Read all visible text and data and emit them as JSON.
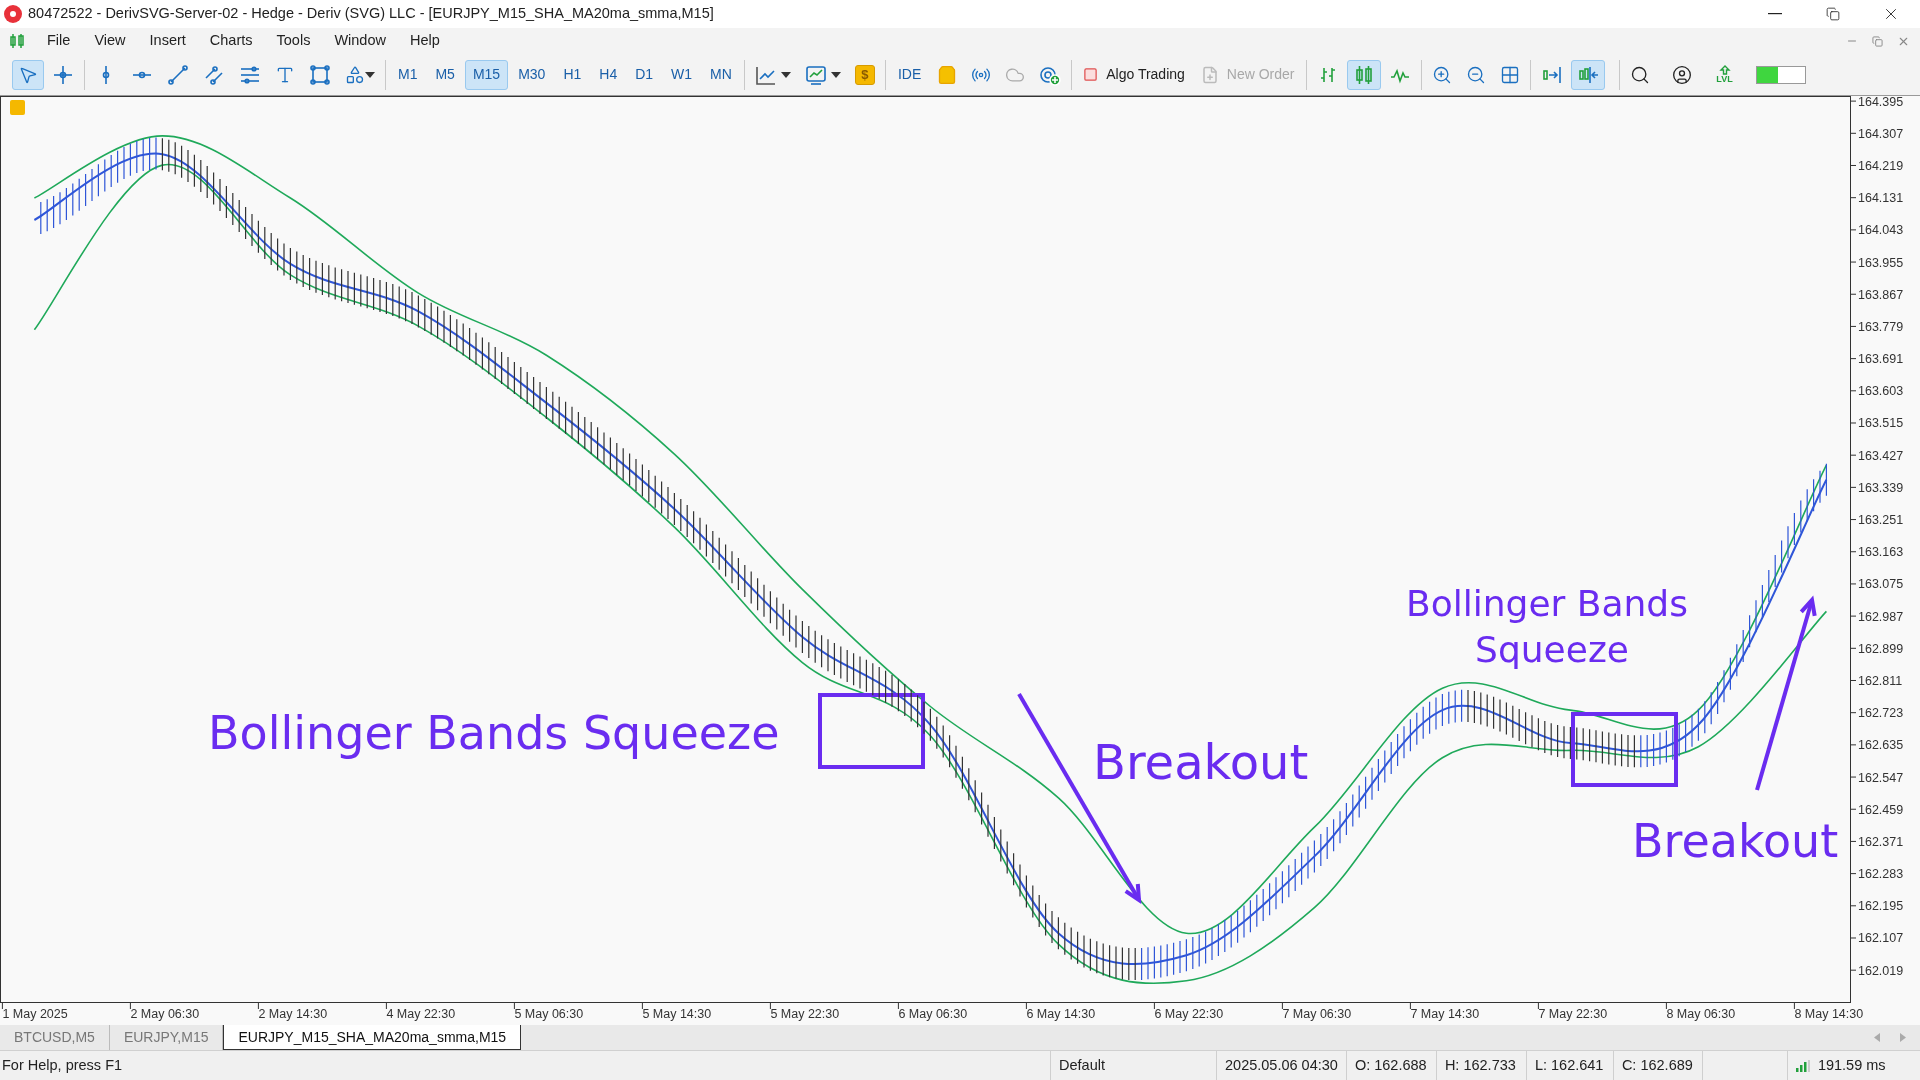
{
  "window": {
    "title": "80472522 - DerivSVG-Server-02 - Hedge - Deriv (SVG) LLC - [EURJPY_M15_SHA_MA20ma_smma,M15]"
  },
  "menu": [
    "File",
    "View",
    "Insert",
    "Charts",
    "Tools",
    "Window",
    "Help"
  ],
  "toolbar": {
    "groups": [
      [
        {
          "kind": "cursor",
          "selected": true
        },
        {
          "kind": "crosshair",
          "selected": false
        }
      ],
      [
        {
          "kind": "vline",
          "selected": false
        },
        {
          "kind": "hline",
          "selected": false
        },
        {
          "kind": "trendline",
          "selected": false
        },
        {
          "kind": "channel",
          "selected": false
        },
        {
          "kind": "fibo",
          "selected": false
        },
        {
          "kind": "text",
          "selected": false
        },
        {
          "kind": "rectangle",
          "selected": false
        },
        {
          "kind": "shapes",
          "selected": false
        }
      ],
      [
        {
          "kind": "timeframe",
          "label": "M1",
          "selected": false
        },
        {
          "kind": "timeframe",
          "label": "M5",
          "selected": false
        },
        {
          "kind": "timeframe",
          "label": "M15",
          "selected": true
        },
        {
          "kind": "timeframe",
          "label": "M30",
          "selected": false
        },
        {
          "kind": "timeframe",
          "label": "H1",
          "selected": false
        },
        {
          "kind": "timeframe",
          "label": "H4",
          "selected": false
        },
        {
          "kind": "timeframe",
          "label": "D1",
          "selected": false
        },
        {
          "kind": "timeframe",
          "label": "W1",
          "selected": false
        },
        {
          "kind": "timeframe",
          "label": "MN",
          "selected": false
        }
      ],
      [
        {
          "kind": "indicators",
          "selected": false
        },
        {
          "kind": "templates",
          "selected": false
        },
        {
          "kind": "dollar",
          "label": "$",
          "selected": false
        }
      ],
      [
        {
          "kind": "label",
          "label": "IDE",
          "selected": false
        },
        {
          "kind": "bag",
          "selected": false
        },
        {
          "kind": "signals",
          "selected": false
        },
        {
          "kind": "cloud",
          "selected": false
        },
        {
          "kind": "radar",
          "selected": false
        }
      ],
      [
        {
          "kind": "algo",
          "label": "Algo Trading",
          "selected": false,
          "disabled": false
        },
        {
          "kind": "order",
          "label": "New Order",
          "selected": false,
          "disabled": true
        }
      ],
      [
        {
          "kind": "bars",
          "selected": false
        },
        {
          "kind": "candles",
          "selected": true
        },
        {
          "kind": "line",
          "selected": false
        }
      ],
      [
        {
          "kind": "zoomin",
          "selected": false
        },
        {
          "kind": "zoomout",
          "selected": false
        },
        {
          "kind": "grid",
          "selected": false
        }
      ],
      [
        {
          "kind": "autoscroll",
          "selected": false
        },
        {
          "kind": "shift",
          "selected": true
        }
      ],
      [
        {
          "kind": "search",
          "selected": false
        },
        {
          "kind": "account",
          "selected": false
        },
        {
          "kind": "lvl",
          "label": "LVL",
          "selected": false
        },
        {
          "kind": "meter",
          "level": 0.45
        }
      ]
    ]
  },
  "chart": {
    "chart_data": {
      "type": "line",
      "categories": [
        "1 May 2025",
        "2 May 06:30",
        "2 May 14:30",
        "4 May 22:30",
        "5 May 06:30",
        "5 May 14:30",
        "5 May 22:30",
        "6 May 06:30",
        "6 May 14:30",
        "6 May 22:30",
        "7 May 06:30",
        "7 May 14:30",
        "7 May 22:30",
        "8 May 06:30",
        "8 May 14:30"
      ],
      "series": [
        {
          "color": "#1fa95a",
          "values": [
            164.13,
            164.3,
            164.13,
            163.87,
            163.7,
            163.43,
            163.06,
            162.74,
            162.49,
            162.12,
            162.41,
            162.79,
            162.73,
            162.73,
            163.4
          ]
        },
        {
          "color": "#2f56d8",
          "values": [
            164.07,
            164.25,
            163.95,
            163.82,
            163.57,
            163.28,
            162.93,
            162.69,
            162.12,
            162.06,
            162.33,
            162.73,
            162.64,
            162.69,
            163.36
          ]
        },
        {
          "color": "#1fa95a",
          "values": [
            163.77,
            164.22,
            163.92,
            163.78,
            163.53,
            163.23,
            162.86,
            162.66,
            162.09,
            161.99,
            162.19,
            162.6,
            162.62,
            162.63,
            163.0
          ]
        }
      ],
      "ylim": [
        161.932,
        164.409
      ],
      "yticks": [
        {
          "value": 164.395,
          "label": "164.395"
        },
        {
          "value": 164.307,
          "label": "164.307"
        },
        {
          "value": 164.219,
          "label": "164.219"
        },
        {
          "value": 164.131,
          "label": "164.131"
        },
        {
          "value": 164.043,
          "label": "164.043"
        },
        {
          "value": 163.955,
          "label": "163.955"
        },
        {
          "value": 163.867,
          "label": "163.867"
        },
        {
          "value": 163.779,
          "label": "163.779"
        },
        {
          "value": 163.691,
          "label": "163.691"
        },
        {
          "value": 163.603,
          "label": "163.603"
        },
        {
          "value": 163.515,
          "label": "163.515"
        },
        {
          "value": 163.427,
          "label": "163.427"
        },
        {
          "value": 163.339,
          "label": "163.339"
        },
        {
          "value": 163.251,
          "label": "163.251"
        },
        {
          "value": 163.163,
          "label": "163.163"
        },
        {
          "value": 163.075,
          "label": "163.075"
        },
        {
          "value": 162.987,
          "label": "162.987"
        },
        {
          "value": 162.899,
          "label": "162.899"
        },
        {
          "value": 162.811,
          "label": "162.811"
        },
        {
          "value": 162.723,
          "label": "162.723"
        },
        {
          "value": 162.635,
          "label": "162.635"
        },
        {
          "value": 162.547,
          "label": "162.547"
        },
        {
          "value": 162.459,
          "label": "162.459"
        },
        {
          "value": 162.371,
          "label": "162.371"
        },
        {
          "value": 162.283,
          "label": "162.283"
        },
        {
          "value": 162.195,
          "label": "162.195"
        },
        {
          "value": 162.107,
          "label": "162.107"
        },
        {
          "value": 162.019,
          "label": "162.019"
        }
      ],
      "annotations": [
        "Bollinger Bands Squeeze",
        "Breakout",
        "Bollinger Bands",
        "Squeeze",
        "Breakout"
      ]
    }
  },
  "chart_tabs": [
    {
      "label": "BTCUSD,M5",
      "selected": false
    },
    {
      "label": "EURJPY,M15",
      "selected": false
    },
    {
      "label": "EURJPY_M15_SHA_MA20ma_smma,M15",
      "selected": true
    }
  ],
  "status_bar": {
    "help": "For Help, press F1",
    "profile": "Default",
    "time": "2025.05.06 04:30",
    "open": "O: 162.688",
    "high": "H: 162.733",
    "low": "L: 162.641",
    "close": "C: 162.689",
    "ping": "191.59 ms"
  }
}
